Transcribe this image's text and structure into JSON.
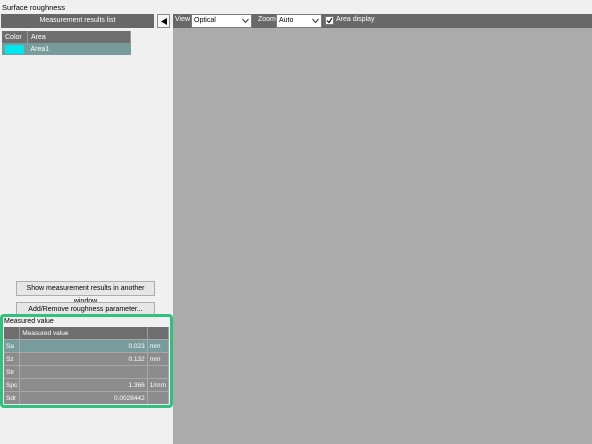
{
  "window": {
    "title": "Surface roughness"
  },
  "left_panel": {
    "header": "Measurement results list",
    "results_table": {
      "columns": [
        "Color",
        "Area"
      ],
      "rows": [
        {
          "color": "#00e5ee",
          "area": "Area1"
        }
      ]
    },
    "buttons": {
      "show_results": "Show measurement results in another window",
      "add_remove": "Add/Remove roughness parameter..."
    }
  },
  "measured": {
    "title": "Measured value",
    "columns": [
      "",
      "Measured value",
      ""
    ],
    "rows": [
      {
        "name": "Sa",
        "value": "0.023",
        "unit": "mm"
      },
      {
        "name": "Sz",
        "value": "0.132",
        "unit": "mm"
      },
      {
        "name": "Str",
        "value": "",
        "unit": ""
      },
      {
        "name": "Spc",
        "value": "1.366",
        "unit": "1/mm"
      },
      {
        "name": "Sdr",
        "value": "0.0028442",
        "unit": ""
      }
    ],
    "highlight_color": "#2ec27e"
  },
  "toolbar": {
    "view_label": "View",
    "view_value": "Optical",
    "zoom_label": "Zoom",
    "zoom_value": "Auto",
    "area_display_label": "Area display",
    "area_display_checked": true
  }
}
